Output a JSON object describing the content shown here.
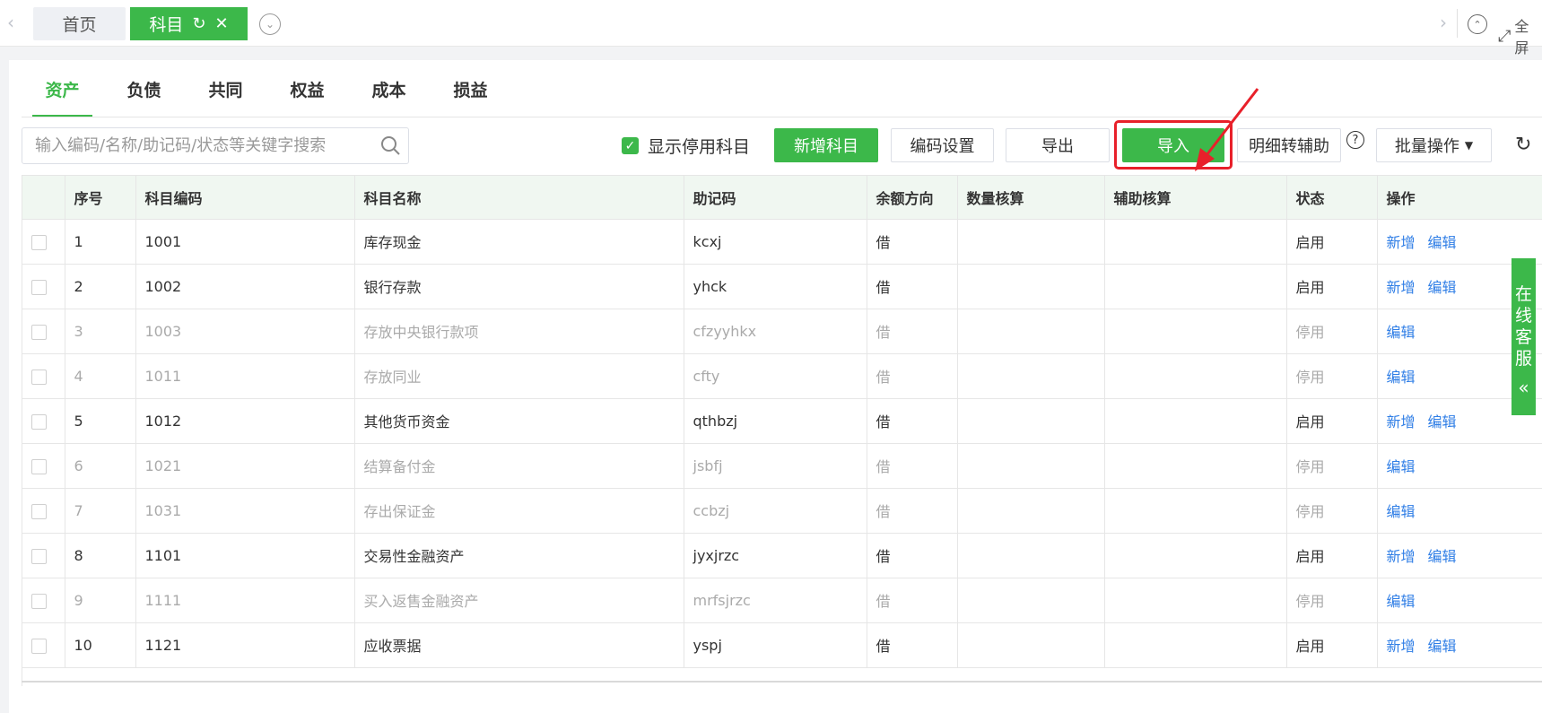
{
  "topbar": {
    "home_tab": "首页",
    "active_tab": "科目",
    "fullscreen_label": "全屏"
  },
  "category_tabs": [
    {
      "label": "资产",
      "active": true
    },
    {
      "label": "负债",
      "active": false
    },
    {
      "label": "共同",
      "active": false
    },
    {
      "label": "权益",
      "active": false
    },
    {
      "label": "成本",
      "active": false
    },
    {
      "label": "损益",
      "active": false
    }
  ],
  "toolbar": {
    "search_placeholder": "输入编码/名称/助记码/状态等关键字搜索",
    "show_disabled_label": "显示停用科目",
    "show_disabled_checked": true,
    "add_subject": "新增科目",
    "code_settings": "编码设置",
    "export": "导出",
    "import": "导入",
    "detail_to_aux": "明细转辅助",
    "batch_ops": "批量操作"
  },
  "table": {
    "headers": [
      "序号",
      "科目编码",
      "科目名称",
      "助记码",
      "余额方向",
      "数量核算",
      "辅助核算",
      "状态",
      "操作"
    ],
    "rows": [
      {
        "no": "1",
        "code": "1001",
        "name": "库存现金",
        "mnemonic": "kcxj",
        "direction": "借",
        "qty": "",
        "aux": "",
        "status": "启用",
        "ops": [
          "新增",
          "编辑"
        ],
        "disabled": false
      },
      {
        "no": "2",
        "code": "1002",
        "name": "银行存款",
        "mnemonic": "yhck",
        "direction": "借",
        "qty": "",
        "aux": "",
        "status": "启用",
        "ops": [
          "新增",
          "编辑"
        ],
        "disabled": false
      },
      {
        "no": "3",
        "code": "1003",
        "name": "存放中央银行款项",
        "mnemonic": "cfzyyhkx",
        "direction": "借",
        "qty": "",
        "aux": "",
        "status": "停用",
        "ops": [
          "编辑"
        ],
        "disabled": true
      },
      {
        "no": "4",
        "code": "1011",
        "name": "存放同业",
        "mnemonic": "cfty",
        "direction": "借",
        "qty": "",
        "aux": "",
        "status": "停用",
        "ops": [
          "编辑"
        ],
        "disabled": true
      },
      {
        "no": "5",
        "code": "1012",
        "name": "其他货币资金",
        "mnemonic": "qthbzj",
        "direction": "借",
        "qty": "",
        "aux": "",
        "status": "启用",
        "ops": [
          "新增",
          "编辑"
        ],
        "disabled": false
      },
      {
        "no": "6",
        "code": "1021",
        "name": "结算备付金",
        "mnemonic": "jsbfj",
        "direction": "借",
        "qty": "",
        "aux": "",
        "status": "停用",
        "ops": [
          "编辑"
        ],
        "disabled": true
      },
      {
        "no": "7",
        "code": "1031",
        "name": "存出保证金",
        "mnemonic": "ccbzj",
        "direction": "借",
        "qty": "",
        "aux": "",
        "status": "停用",
        "ops": [
          "编辑"
        ],
        "disabled": true
      },
      {
        "no": "8",
        "code": "1101",
        "name": "交易性金融资产",
        "mnemonic": "jyxjrzc",
        "direction": "借",
        "qty": "",
        "aux": "",
        "status": "启用",
        "ops": [
          "新增",
          "编辑"
        ],
        "disabled": false
      },
      {
        "no": "9",
        "code": "1111",
        "name": "买入返售金融资产",
        "mnemonic": "mrfsjrzc",
        "direction": "借",
        "qty": "",
        "aux": "",
        "status": "停用",
        "ops": [
          "编辑"
        ],
        "disabled": true
      },
      {
        "no": "10",
        "code": "1121",
        "name": "应收票据",
        "mnemonic": "yspj",
        "direction": "借",
        "qty": "",
        "aux": "",
        "status": "启用",
        "ops": [
          "新增",
          "编辑"
        ],
        "disabled": false
      }
    ]
  },
  "service": {
    "chars": [
      "在",
      "线",
      "客",
      "服"
    ]
  },
  "colors": {
    "brand_green": "#3cb84a",
    "link_blue": "#2f7ee6",
    "annotation_red": "#e8202a"
  },
  "icons": {
    "refresh": "refresh-icon",
    "close": "close-icon",
    "search": "search-icon",
    "help": "help-icon",
    "fullscreen": "fullscreen-icon"
  }
}
